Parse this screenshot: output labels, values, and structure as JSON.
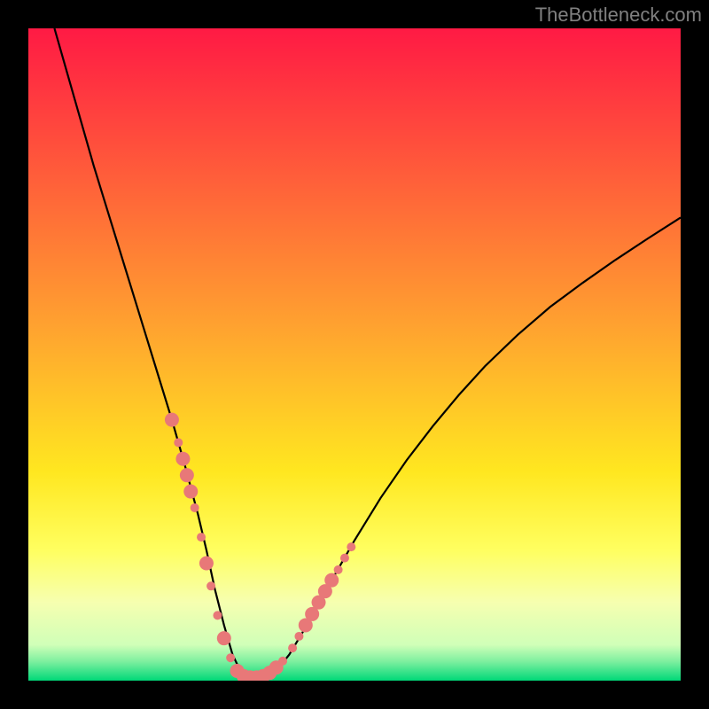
{
  "watermark": "TheBottleneck.com",
  "chart_data": {
    "type": "line",
    "title": "",
    "xlabel": "",
    "ylabel": "",
    "xlim": [
      0,
      100
    ],
    "ylim": [
      0,
      100
    ],
    "background_gradient": {
      "stops": [
        {
          "offset": 0.0,
          "color": "#ff1a44"
        },
        {
          "offset": 0.45,
          "color": "#ffa030"
        },
        {
          "offset": 0.68,
          "color": "#ffe720"
        },
        {
          "offset": 0.8,
          "color": "#ffff60"
        },
        {
          "offset": 0.88,
          "color": "#f6ffb0"
        },
        {
          "offset": 0.945,
          "color": "#d0ffb8"
        },
        {
          "offset": 0.97,
          "color": "#80f0a0"
        },
        {
          "offset": 1.0,
          "color": "#00d878"
        }
      ]
    },
    "series": [
      {
        "name": "bottleneck-curve",
        "x": [
          4,
          6,
          8,
          10,
          12,
          14,
          16,
          18,
          20,
          22,
          24,
          26,
          27.3,
          28.6,
          30,
          31.3,
          32.5,
          34,
          36,
          38,
          40,
          43,
          46,
          50,
          54,
          58,
          62,
          66,
          70,
          75,
          80,
          85,
          90,
          95,
          100
        ],
        "y": [
          100,
          93,
          86,
          79,
          72.5,
          66,
          59.5,
          53,
          46.5,
          40,
          33,
          25.5,
          20,
          14,
          8.5,
          4,
          1.5,
          0.5,
          0.5,
          1.5,
          4,
          9,
          14.5,
          21.5,
          28,
          33.8,
          39,
          43.8,
          48.2,
          53,
          57.3,
          61,
          64.5,
          67.8,
          71
        ],
        "color": "#000000"
      }
    ],
    "markers": {
      "name": "highlight-points",
      "color": "#e87878",
      "radius_small": 5,
      "radius_large": 8,
      "points": [
        {
          "x": 22.0,
          "y": 40.0,
          "r": "large"
        },
        {
          "x": 23.0,
          "y": 36.5,
          "r": "small"
        },
        {
          "x": 23.7,
          "y": 34.0,
          "r": "large"
        },
        {
          "x": 24.3,
          "y": 31.5,
          "r": "large"
        },
        {
          "x": 24.9,
          "y": 29.0,
          "r": "large"
        },
        {
          "x": 25.5,
          "y": 26.5,
          "r": "small"
        },
        {
          "x": 26.5,
          "y": 22.0,
          "r": "small"
        },
        {
          "x": 27.3,
          "y": 18.0,
          "r": "large"
        },
        {
          "x": 28.0,
          "y": 14.5,
          "r": "small"
        },
        {
          "x": 29.0,
          "y": 10.0,
          "r": "small"
        },
        {
          "x": 30.0,
          "y": 6.5,
          "r": "large"
        },
        {
          "x": 31.0,
          "y": 3.5,
          "r": "small"
        },
        {
          "x": 32.0,
          "y": 1.5,
          "r": "large"
        },
        {
          "x": 33.0,
          "y": 0.7,
          "r": "large"
        },
        {
          "x": 34.0,
          "y": 0.5,
          "r": "large"
        },
        {
          "x": 35.0,
          "y": 0.5,
          "r": "large"
        },
        {
          "x": 36.0,
          "y": 0.7,
          "r": "large"
        },
        {
          "x": 37.0,
          "y": 1.2,
          "r": "large"
        },
        {
          "x": 38.0,
          "y": 2.0,
          "r": "large"
        },
        {
          "x": 39.0,
          "y": 3.0,
          "r": "small"
        },
        {
          "x": 40.5,
          "y": 5.0,
          "r": "small"
        },
        {
          "x": 41.5,
          "y": 6.8,
          "r": "small"
        },
        {
          "x": 42.5,
          "y": 8.5,
          "r": "large"
        },
        {
          "x": 43.5,
          "y": 10.2,
          "r": "large"
        },
        {
          "x": 44.5,
          "y": 12.0,
          "r": "large"
        },
        {
          "x": 45.5,
          "y": 13.7,
          "r": "large"
        },
        {
          "x": 46.5,
          "y": 15.4,
          "r": "large"
        },
        {
          "x": 47.5,
          "y": 17.0,
          "r": "small"
        },
        {
          "x": 48.5,
          "y": 18.8,
          "r": "small"
        },
        {
          "x": 49.5,
          "y": 20.5,
          "r": "small"
        }
      ]
    }
  }
}
